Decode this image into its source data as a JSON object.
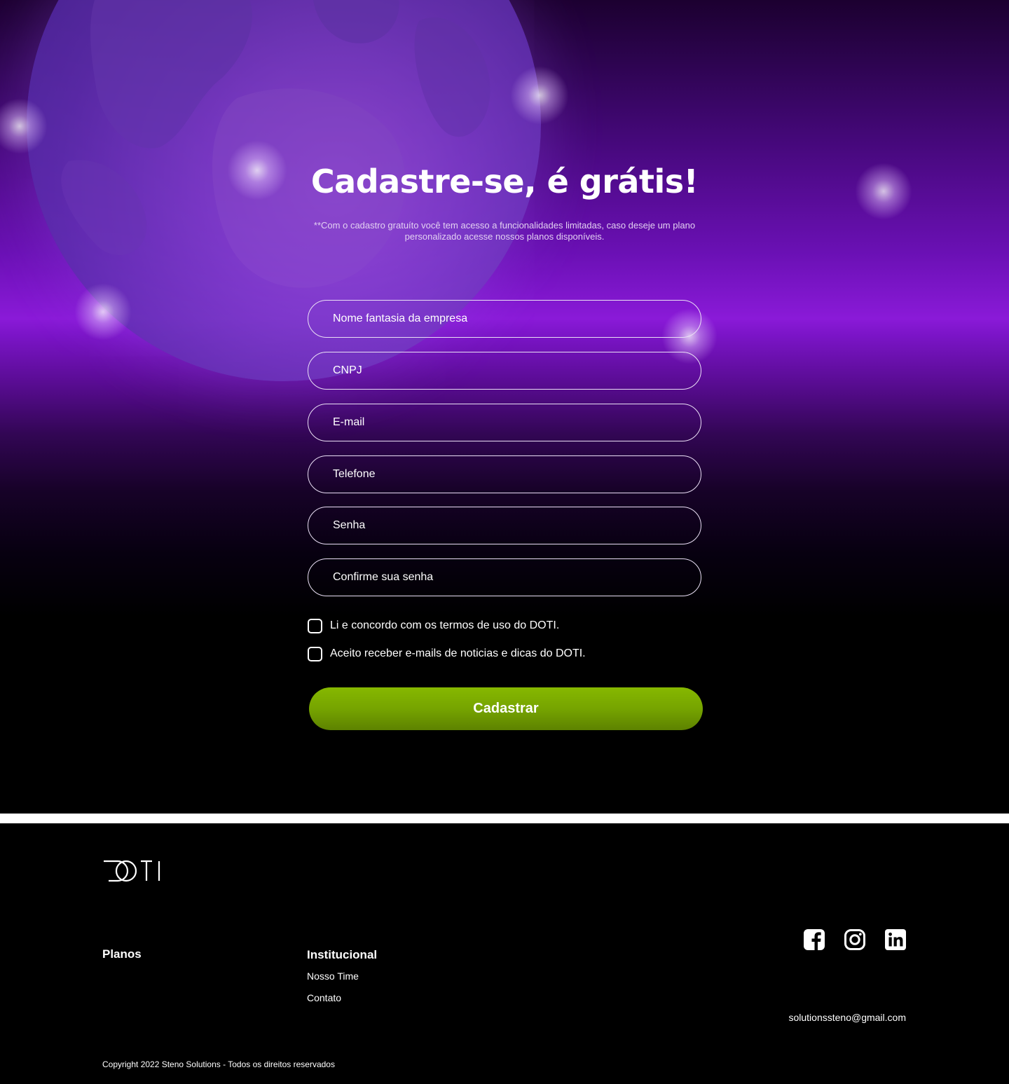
{
  "hero": {
    "title": "Cadastre-se, é grátis!",
    "subtitle": "**Com o cadastro gratuíto você tem acesso a funcionalidades limitadas, caso deseje um plano personalizado acesse nossos planos disponíveis."
  },
  "form": {
    "company_placeholder": "Nome fantasia da empresa",
    "cnpj_placeholder": "CNPJ",
    "email_placeholder": "E-mail",
    "phone_placeholder": "Telefone",
    "password_placeholder": "Senha",
    "confirm_placeholder": "Confirme sua senha",
    "terms_label": "Li e concordo com os termos de uso do DOTI.",
    "newsletter_label": "Aceito receber e-mails de noticias e dicas do DOTI.",
    "terms_checked": false,
    "newsletter_checked": false,
    "submit_label": "Cadastrar",
    "submit_color": "#7aaa00"
  },
  "footer": {
    "logo_text": "DOTI",
    "planos_heading": "Planos",
    "institucional_heading": "Institucional",
    "links": [
      "Nosso Time",
      "Contato"
    ],
    "social": [
      "facebook-icon",
      "instagram-icon",
      "linkedin-icon"
    ],
    "email": "solutionssteno@gmail.com",
    "copyright": "Copyright 2022 Steno Solutions - Todos os direitos reservados"
  },
  "colors": {
    "hero_purple": "#8a1ad8",
    "globe_purple": "#7e3fcc",
    "accent_green": "#7aaa00",
    "background": "#000000"
  }
}
